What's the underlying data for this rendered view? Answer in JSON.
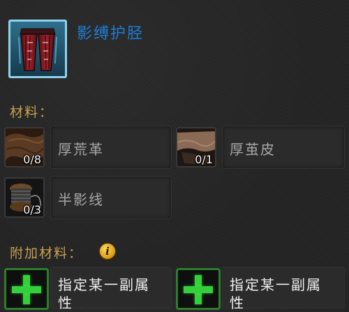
{
  "item": {
    "name": "影缚护胫",
    "icon": "shadowbound-leggings-icon",
    "quality_color": "#1f7dd6"
  },
  "materials_section": {
    "label": "材料："
  },
  "materials": [
    {
      "name": "厚荒革",
      "count": "0/8",
      "icon": "dense-hide-icon"
    },
    {
      "name": "厚茧皮",
      "count": "0/1",
      "icon": "callous-hide-icon"
    },
    {
      "name": "半影线",
      "count": "0/3",
      "icon": "penumbra-thread-icon"
    }
  ],
  "optional_section": {
    "label": "附加材料：",
    "info_glyph": "i"
  },
  "optional_slots": [
    {
      "text": "指定某一副属性"
    },
    {
      "text": "指定某一副属性"
    }
  ],
  "colors": {
    "section_label": "#c8a052",
    "material_text": "#a6a6a6",
    "add_plus": "#34d03c"
  }
}
